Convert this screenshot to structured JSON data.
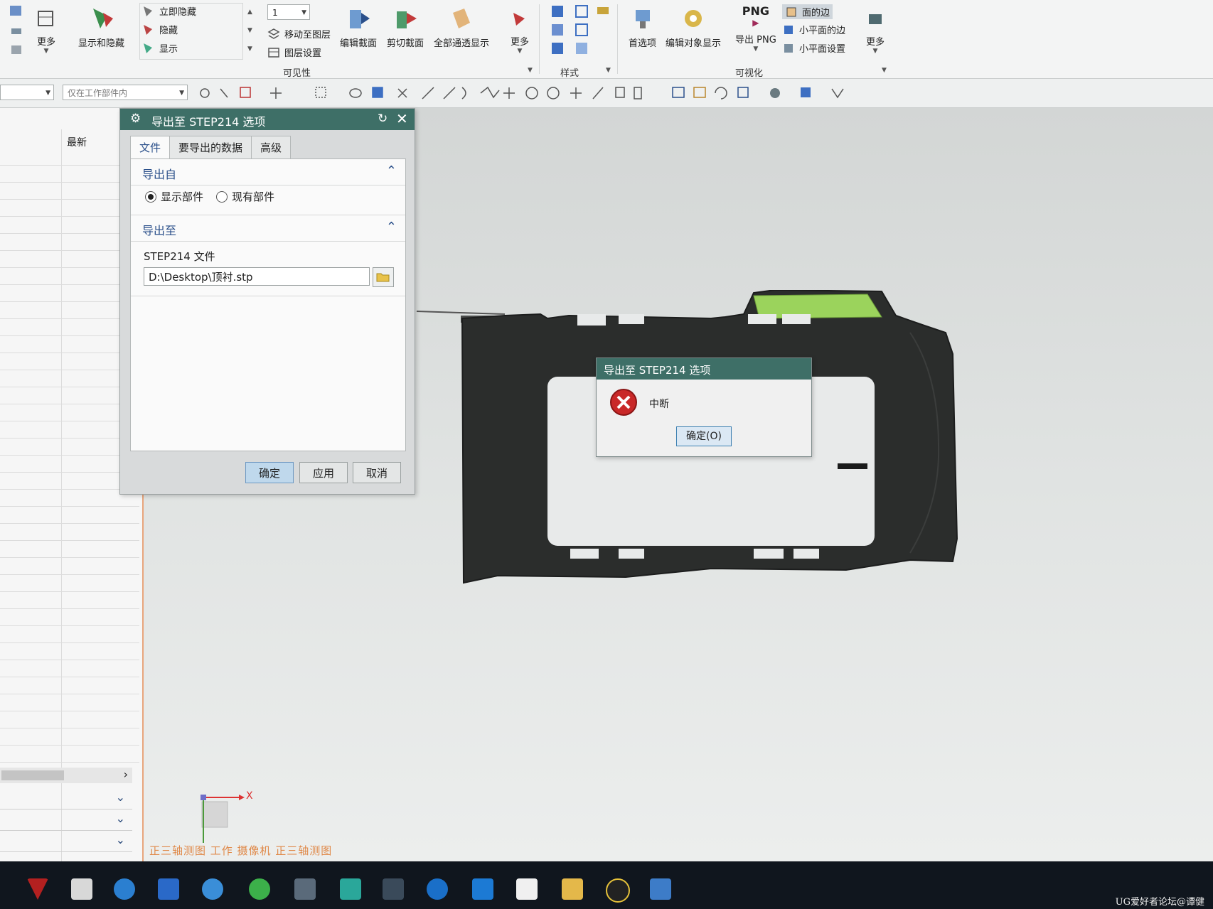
{
  "ribbon": {
    "more_left": "更多",
    "show_hide": "显示和隐藏",
    "hide_now": "立即隐藏",
    "hide": "隐藏",
    "show": "显示",
    "layer_value": "1",
    "move_to_layer": "移动至图层",
    "layer_settings": "图层设置",
    "edit_section": "编辑截面",
    "clip_section": "剪切截面",
    "full_transparency": "全部通透显示",
    "more_visibility": "更多",
    "group_visibility": "可见性",
    "group_style": "样式",
    "preferences": "首选项",
    "edit_object_display": "编辑对象显示",
    "png_badge": "PNG",
    "export_png": "导出 PNG",
    "face_edges": "面的边",
    "facet_edges": "小平面的边",
    "facet_settings": "小平面设置",
    "more_right": "更多",
    "group_visualization": "可视化"
  },
  "selection_bar": {
    "scope_filter": "仅在工作部件内"
  },
  "navigator": {
    "column_latest": "最新"
  },
  "dialog": {
    "title": "导出至 STEP214 选项",
    "tabs": [
      "文件",
      "要导出的数据",
      "高级"
    ],
    "section_export_from": "导出自",
    "radio_displayed_part": "显示部件",
    "radio_existing_part": "现有部件",
    "section_export_to": "导出至",
    "file_label": "STEP214 文件",
    "file_path": "D:\\Desktop\\顶衬.stp",
    "ok": "确定",
    "apply": "应用",
    "cancel": "取消"
  },
  "error_popup": {
    "title": "导出至 STEP214 选项",
    "message": "中断",
    "ok": "确定(O)"
  },
  "viewport": {
    "view_label": "正三轴测图 工作 摄像机 正三轴测图",
    "axis_x": "X"
  },
  "watermark": "UG爱好者论坛@谭健",
  "colors": {
    "title_bar": "#3e6f67",
    "accent_blue": "#2a4f8a",
    "view_label": "#e08a4a",
    "part_dark": "#2b2d2c",
    "part_green": "#9bd35c"
  }
}
